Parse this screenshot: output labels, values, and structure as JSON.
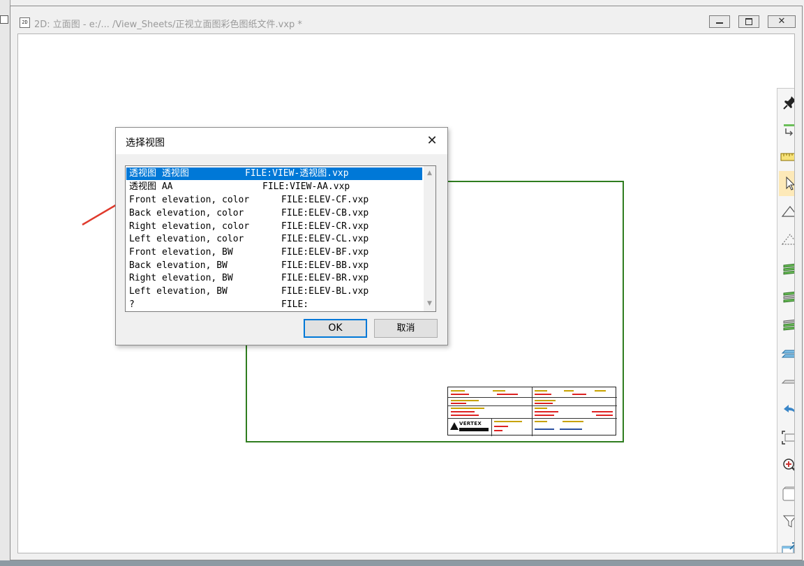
{
  "window": {
    "title": "2D: 立面图 - e:/... /View_Sheets/正视立面图彩色图纸文件.vxp *",
    "app_icon": "app-document-icon",
    "close_glyph": "✕"
  },
  "dialog": {
    "title": "选择视图",
    "close_glyph": "✕",
    "items": [
      {
        "name": "透视图 透视图",
        "file": "FILE:VIEW-透视图.vxp",
        "selected": true
      },
      {
        "name": "透视图 AA",
        "file": "FILE:VIEW-AA.vxp"
      },
      {
        "name": "Front elevation, color",
        "file": "FILE:ELEV-CF.vxp"
      },
      {
        "name": "Back elevation, color",
        "file": "FILE:ELEV-CB.vxp"
      },
      {
        "name": "Right elevation, color",
        "file": "FILE:ELEV-CR.vxp"
      },
      {
        "name": "Left elevation, color",
        "file": "FILE:ELEV-CL.vxp"
      },
      {
        "name": "Front elevation, BW",
        "file": "FILE:ELEV-BF.vxp"
      },
      {
        "name": "Back elevation, BW",
        "file": "FILE:ELEV-BB.vxp"
      },
      {
        "name": "Right elevation, BW",
        "file": "FILE:ELEV-BR.vxp"
      },
      {
        "name": "Left elevation, BW",
        "file": "FILE:ELEV-BL.vxp"
      },
      {
        "name": "?",
        "file": "FILE:"
      }
    ],
    "ok_label": "OK",
    "cancel_label": "取消"
  },
  "titleblock": {
    "logo_text": "VERTEX"
  },
  "toolbar": [
    {
      "name": "pin-icon",
      "active": false
    },
    {
      "name": "snap-icon",
      "active": false
    },
    {
      "name": "ruler-icon",
      "active": false
    },
    {
      "name": "select-arrow-icon",
      "active": true
    },
    {
      "name": "triangle-icon",
      "active": false
    },
    {
      "name": "dashed-triangle-icon",
      "active": false
    },
    {
      "name": "layers-green-icon",
      "active": false
    },
    {
      "name": "layers-gray-icon",
      "active": false
    },
    {
      "name": "layers-mixed-icon",
      "active": false
    },
    {
      "name": "plane-blue-icon",
      "active": false
    },
    {
      "name": "plane-gray-icon",
      "active": false
    },
    {
      "name": "undo-arrow-icon",
      "active": false
    },
    {
      "name": "zoom-extents-icon",
      "active": false
    },
    {
      "name": "zoom-in-icon",
      "active": false
    },
    {
      "name": "page-icon",
      "active": false
    },
    {
      "name": "filter-icon",
      "active": false
    },
    {
      "name": "export-window-icon",
      "active": false
    }
  ],
  "colors": {
    "selection": "#0078d7",
    "sheet_border": "#2f7d1f",
    "active_tool": "#fde9b8",
    "annotation_arrow": "#e03a2c"
  }
}
